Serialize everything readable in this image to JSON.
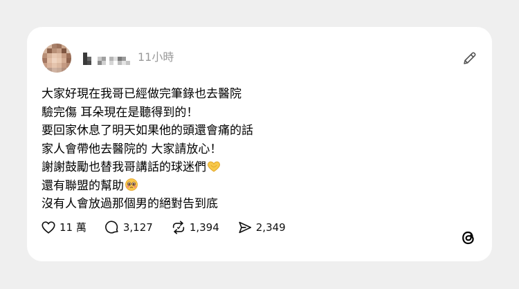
{
  "post": {
    "timestamp": "11小時",
    "lines": [
      "大家好現在我哥已經做完筆錄也去醫院",
      "驗完傷 耳朵現在是聽得到的！",
      "要回家休息了明天如果他的頭還會痛的話",
      "家人會帶他去醫院的 大家請放心！",
      "謝謝鼓勵也替我哥講話的球迷們",
      "還有聯盟的幫助",
      "沒有人會放過那個男的絕對告到底"
    ]
  },
  "actions": {
    "likes": "11 萬",
    "comments": "3,127",
    "reposts": "1,394",
    "shares": "2,349"
  },
  "icons": {
    "edit": "pencil-icon",
    "like": "heart-icon",
    "comment": "speech-bubble-icon",
    "repost": "repost-icon",
    "share": "send-icon",
    "brand": "threads-logo-icon",
    "emoji_line_5": "heart-hands-emoji",
    "emoji_line_6": "pleading-face-emoji"
  },
  "colors": {
    "background": "#efefef",
    "card": "#ffffff",
    "text": "#000000",
    "muted": "#999999"
  }
}
